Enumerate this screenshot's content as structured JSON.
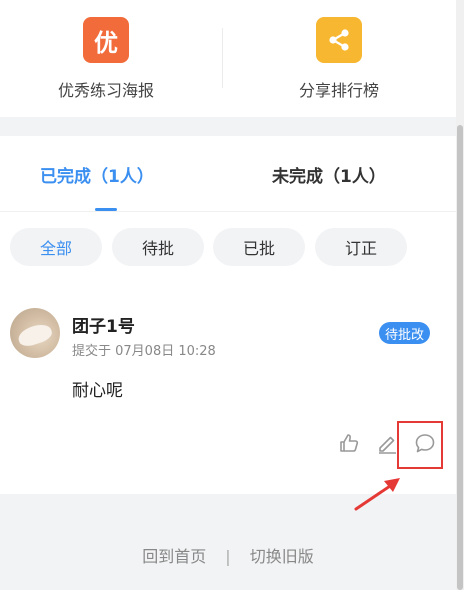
{
  "actions": [
    {
      "label": "优秀练习海报",
      "icon": "poster-icon",
      "glyph": "优"
    },
    {
      "label": "分享排行榜",
      "icon": "share-icon"
    }
  ],
  "tabs": [
    {
      "label": "已完成（1人）",
      "active": true
    },
    {
      "label": "未完成（1人）",
      "active": false
    }
  ],
  "filters": [
    {
      "label": "全部",
      "active": true
    },
    {
      "label": "待批",
      "active": false
    },
    {
      "label": "已批",
      "active": false
    },
    {
      "label": "订正",
      "active": false
    }
  ],
  "entry": {
    "name": "团子1号",
    "time": "提交于 07月08日 10:28",
    "status": "待批改",
    "content": "耐心呢"
  },
  "footer": {
    "home": "回到首页",
    "separator": "|",
    "switch": "切换旧版"
  },
  "colors": {
    "accent": "#3b8ff0",
    "poster_icon_bg": "#f26b3a",
    "share_icon_bg": "#f7b731",
    "highlight": "#e53935"
  }
}
